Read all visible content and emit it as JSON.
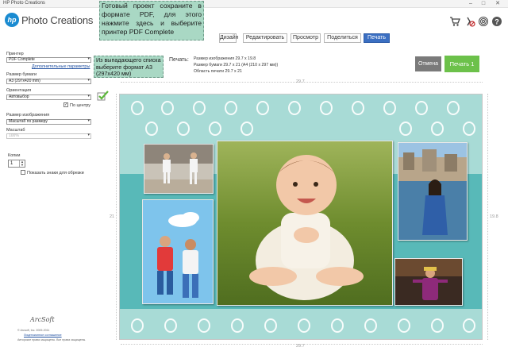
{
  "window": {
    "title": "HP Photo Creations",
    "minimize_glyph": "–",
    "maximize_glyph": "□",
    "close_glyph": "✕"
  },
  "brand": {
    "logo_text": "hp",
    "app_name": "Photo Creations"
  },
  "toolbar_icons": [
    "cart-icon",
    "no-ads-icon",
    "fingerprint-icon",
    "help-icon"
  ],
  "callouts": {
    "save_pdf": "Готовый проект сохраните в формате PDF, для этого нажмите здесь и выберите принтер PDF Complete",
    "paper_size": "Из выпадающего списка выберите формат А3 (297х420 мм)"
  },
  "tabs": [
    {
      "label": "Дизайн",
      "active": false
    },
    {
      "label": "Редактировать",
      "active": false
    },
    {
      "label": "Просмотр",
      "active": false
    },
    {
      "label": "Поделиться",
      "active": false
    },
    {
      "label": "Печать",
      "active": true
    }
  ],
  "print_info": {
    "label": "Печать:",
    "line1": "Размер изображения 29.7 x 19.8",
    "line2": "Размер бумаги 29.7 x 21 (A4 (210 x 297 мм))",
    "line3": "Область печати 29.7 x 21"
  },
  "buttons": {
    "cancel": "Отмена",
    "print": "Печать 1"
  },
  "left_panel": {
    "printer_label": "Принтер",
    "printer_value": "PDF Complete",
    "advanced_link": "Дополнительные параметры",
    "paper_label": "Размер бумаги",
    "paper_value": "A3 (297x420 mm)",
    "orientation_label": "Ориентация",
    "orientation_value": "Автовыбор",
    "center_label": "По центру",
    "center_checked": true,
    "image_size_label": "Размер изображения",
    "image_size_value": "Масштаб по размеру",
    "scale_label": "Масштаб",
    "scale_value": "100%",
    "copies_label": "Копии",
    "copies_value": "1",
    "crop_marks_label": "Показать знаки для обрезки",
    "crop_marks_checked": false,
    "footer_line1": "© Arcsoft, Inc. 2009-2011",
    "footer_line2": "Лицензионное соглашение",
    "footer_line3": "Авторские права защищены. Все права защищены."
  },
  "ruler": {
    "top": "29.7",
    "bottom": "29.7",
    "left": "21",
    "right": "19.8"
  },
  "colors": {
    "accent_blue": "#3b6fc2",
    "print_green": "#6cc14a",
    "cancel_gray": "#7a7a7a",
    "callout_green": "#a9d8c4",
    "canvas_teal": "#9fd6d1"
  }
}
